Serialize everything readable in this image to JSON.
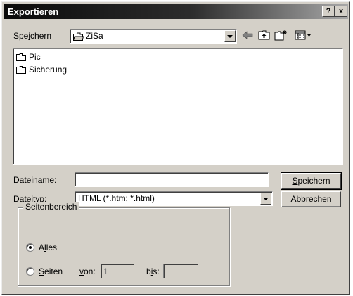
{
  "window": {
    "title": "Exportieren",
    "help_label": "?",
    "close_label": "x"
  },
  "save_in": {
    "label_pre": "Spe",
    "label_accel": "i",
    "label_post": "chern",
    "folder": "ZiSa"
  },
  "files": [
    {
      "name": "Pic"
    },
    {
      "name": "Sicherung"
    }
  ],
  "filename": {
    "label_pre": "Datei",
    "label_accel": "n",
    "label_post": "ame:",
    "value": ""
  },
  "filetype": {
    "label_pre": "Datei",
    "label_accel": "t",
    "label_post": "yp:",
    "value": "HTML (*.htm; *.html)"
  },
  "buttons": {
    "save_accel": "S",
    "save_rest": "peichern",
    "cancel": "Abbrechen"
  },
  "page_range": {
    "title": "Seitenbereich",
    "all_pre": "A",
    "all_accel": "l",
    "all_post": "les",
    "pages_accel": "S",
    "pages_post": "eiten",
    "from_accel": "v",
    "from_post": "on:",
    "from_value": "1",
    "to_pre": "b",
    "to_accel": "i",
    "to_post": "s:",
    "to_value": "",
    "selected": "all"
  }
}
